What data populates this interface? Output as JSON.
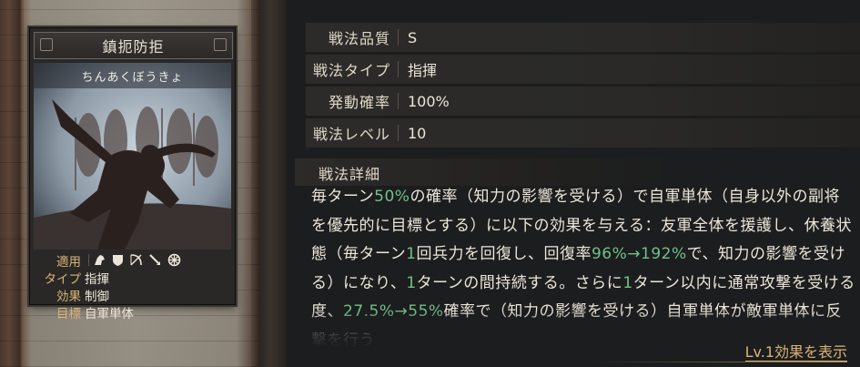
{
  "card": {
    "title": "鎮扼防拒",
    "reading": "ちんあくぼうきょ",
    "info": {
      "equip_label": "適用",
      "equip_icons": [
        "cavalry-icon",
        "shield-icon",
        "bow-icon",
        "spear-icon",
        "siege-wheel-icon"
      ],
      "type_label": "タイプ",
      "type_value": "指揮",
      "effect_label": "効果",
      "effect_value": "制御",
      "target_label": "目標",
      "target_value": "自軍単体"
    }
  },
  "stats": [
    {
      "label": "戦法品質",
      "value": "S"
    },
    {
      "label": "戦法タイプ",
      "value": "指揮"
    },
    {
      "label": "発動確率",
      "value": "100%"
    },
    {
      "label": "戦法レベル",
      "value": "10"
    }
  ],
  "detail": {
    "title": "戦法詳細",
    "segments": [
      {
        "text": "毎ターン",
        "highlight": false
      },
      {
        "text": "50%",
        "highlight": true
      },
      {
        "text": "の確率（知力の影響を受ける）で自軍単体（自身以外の副将を優先的に目標とする）に以下の効果を与える：友軍全体を援護し、休養状態（毎ターン",
        "highlight": false
      },
      {
        "text": "1",
        "highlight": true
      },
      {
        "text": "回兵力を回復し、回復率",
        "highlight": false
      },
      {
        "text": "96%→192%",
        "highlight": true
      },
      {
        "text": "で、知力の影響を受ける）になり、",
        "highlight": false
      },
      {
        "text": "1",
        "highlight": true
      },
      {
        "text": "ターンの間持続する。さらに",
        "highlight": false
      },
      {
        "text": "1",
        "highlight": true
      },
      {
        "text": "ターン以内に通常攻撃を受ける度、",
        "highlight": false
      },
      {
        "text": "27.5%→55%",
        "highlight": true
      },
      {
        "text": "確率で（知力の影響を受ける）自軍単体が敵軍単体に反撃を行う",
        "highlight": false
      }
    ]
  },
  "more_link": "Lv.1効果を表示",
  "colors": {
    "accent": "#d8b476",
    "highlight": "#72c08a",
    "text": "#ece6da"
  }
}
